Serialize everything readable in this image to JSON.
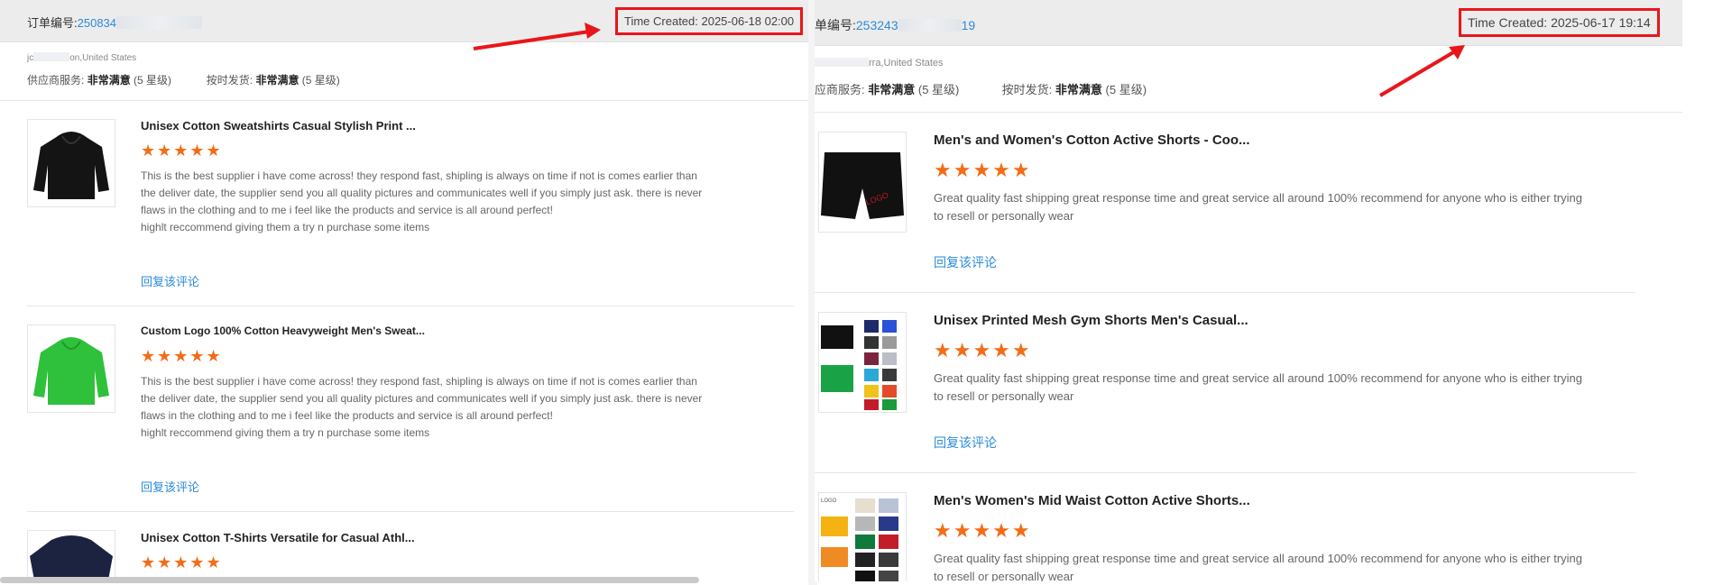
{
  "left": {
    "order_label": "订单编号:",
    "order_number_visible": "250834",
    "time_created": "Time Created: 2025-06-18 02:00",
    "location": "on,United States",
    "location_prefix": "jc",
    "supplier_service_label": "供应商服务:",
    "supplier_service_value": "非常满意",
    "supplier_service_level": "(5 星级)",
    "ship_label": "按时发货:",
    "ship_value": "非常满意",
    "ship_level": "(5 星级)",
    "reviews": [
      {
        "title": "Unisex Cotton Sweatshirts Casual Stylish Print ...",
        "stars": "★★★★★",
        "text": "This is the best supplier i have come across! they respond fast, shipling is always on time if not is comes earlier than the deliver date, the supplier send you all quality pictures and communicates well if you simply just ask. there is never flaws in the clothing and to me i feel like the products and service is all around perfect!\nhighlt reccommend giving them a try n purchase some items",
        "reply": "回复该评论",
        "thumb": "black-hoodie"
      },
      {
        "title": "Custom Logo 100% Cotton Heavyweight Men's Sweat...",
        "stars": "★★★★★",
        "text": "This is the best supplier i have come across! they respond fast, shipling is always on time if not is comes earlier than the deliver date, the supplier send you all quality pictures and communicates well if you simply just ask. there is never flaws in the clothing and to me i feel like the products and service is all around perfect!\nhighlt reccommend giving them a try n purchase some items",
        "reply": "回复该评论",
        "thumb": "green-hoodie"
      },
      {
        "title": "Unisex Cotton T-Shirts Versatile for Casual Athl...",
        "stars": "★★★★★",
        "thumb": "navy-tshirt"
      }
    ]
  },
  "right": {
    "order_label": "单编号:",
    "order_number_visible": "253243",
    "order_number_tail": "19",
    "time_created": "Time Created: 2025-06-17 19:14",
    "location": "rra,United States",
    "supplier_service_label": "应商服务:",
    "supplier_service_value": "非常满意",
    "supplier_service_level": "(5 星级)",
    "ship_label": "按时发货:",
    "ship_value": "非常满意",
    "ship_level": "(5 星级)",
    "reviews": [
      {
        "title": "Men's and Women's Cotton Active Shorts - Coo...",
        "stars": "★★★★★",
        "text": "Great quality fast shipping great response time and great service all around 100% recommend for anyone who is either trying to resell or personally wear",
        "reply": "回复该评论",
        "thumb": "black-shorts",
        "thumb_text": "LOGO"
      },
      {
        "title": "Unisex Printed Mesh Gym Shorts Men's Casual...",
        "stars": "★★★★★",
        "text": "Great quality fast shipping great response time and great service all around 100% recommend for anyone who is either trying to resell or personally wear",
        "reply": "回复该评论",
        "thumb": "multicolor-shorts"
      },
      {
        "title": "Men's Women's Mid Waist Cotton Active Shorts...",
        "stars": "★★★★★",
        "text": "Great quality fast shipping great response time and great service all around 100% recommend for anyone who is either trying to resell or personally wear",
        "thumb": "color-grid-shorts",
        "thumb_text": "LOGO"
      }
    ]
  },
  "colors": {
    "accent_blue": "#2b8ad8",
    "star_orange": "#f36c16",
    "highlight_red": "#e8161b"
  }
}
